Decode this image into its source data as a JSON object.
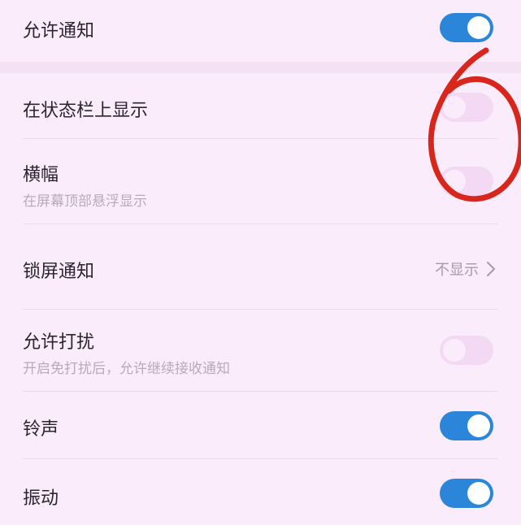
{
  "settings": [
    {
      "id": "allow_notifications",
      "title": "允许通知",
      "subtitle": "",
      "control": "toggle",
      "on": true
    },
    {
      "id": "status_bar",
      "title": "在状态栏上显示",
      "subtitle": "",
      "control": "toggle",
      "on": false
    },
    {
      "id": "banner",
      "title": "横幅",
      "subtitle": "在屏幕顶部悬浮显示",
      "control": "toggle",
      "on": false
    },
    {
      "id": "lockscreen",
      "title": "锁屏通知",
      "subtitle": "",
      "control": "select",
      "value": "不显示"
    },
    {
      "id": "allow_dnd",
      "title": "允许打扰",
      "subtitle": "开启免打扰后，允许继续接收通知",
      "control": "toggle",
      "on": false
    },
    {
      "id": "ringtone",
      "title": "铃声",
      "subtitle": "",
      "control": "toggle",
      "on": true
    },
    {
      "id": "vibration",
      "title": "振动",
      "subtitle": "",
      "control": "toggle",
      "on": true
    }
  ],
  "colors": {
    "background": "#fbecfb",
    "toggle_on": "#2b86d9",
    "toggle_off": "#f3d9f3",
    "annotation": "#d9261c"
  },
  "icons": {
    "chevron": "chevron-right-icon",
    "annotation": "hand-drawn-circle"
  }
}
